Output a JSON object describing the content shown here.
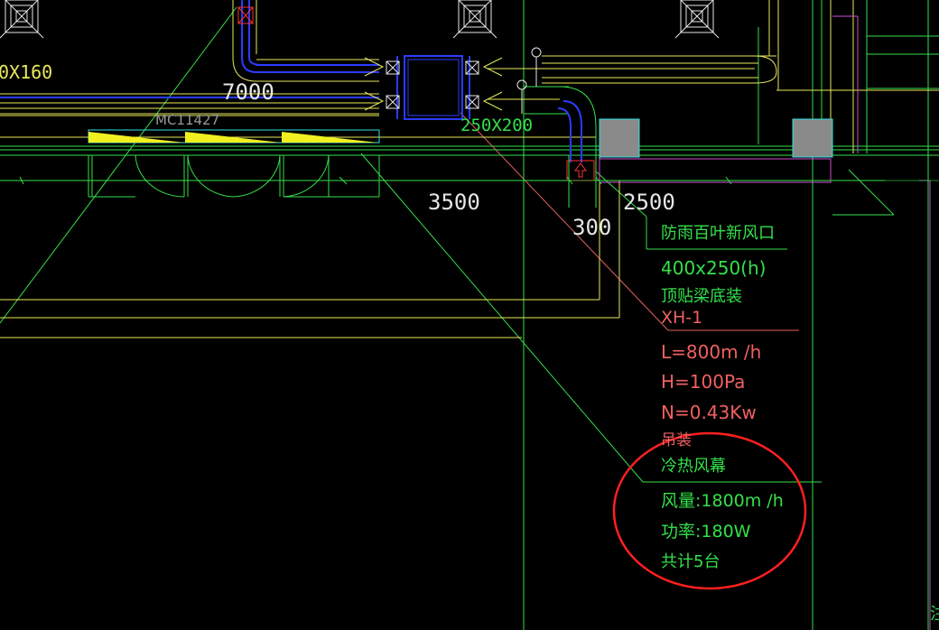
{
  "colors": {
    "background": "#000000",
    "green": "#33e04a",
    "yellow": "#e8e85a",
    "blue": "#2a3cff",
    "red": "#ff3030",
    "magenta": "#d050d0",
    "cyan": "#30e0e0",
    "gray_fill": "#8a8a8a",
    "highlight_circle": "#ff2020"
  },
  "dimensions": {
    "left_duct": "0X160",
    "d7000": "7000",
    "d3500": "3500",
    "d300": "300",
    "d2500": "2500",
    "duct_250x200": "250X200"
  },
  "labels": {
    "door": "MC11427",
    "louver": "防雨百叶新风口",
    "louver_size": "400x250(h)",
    "mount_beam": "顶贴梁底装",
    "unit_tag": "XH-1",
    "airflow": "L=800m /h",
    "pressure": "H=100Pa",
    "power": "N=0.43Kw",
    "hanging": "吊装",
    "curtain_title": "冷热风幕",
    "curtain_airflow": "风量:1800m /h",
    "curtain_power": "功率:180W",
    "curtain_count": "共计5台",
    "edge_char": "注"
  },
  "icons": [
    "ceiling-diffuser-icon",
    "fan-icon",
    "damper-icon",
    "air-intake-arrow-icon"
  ]
}
